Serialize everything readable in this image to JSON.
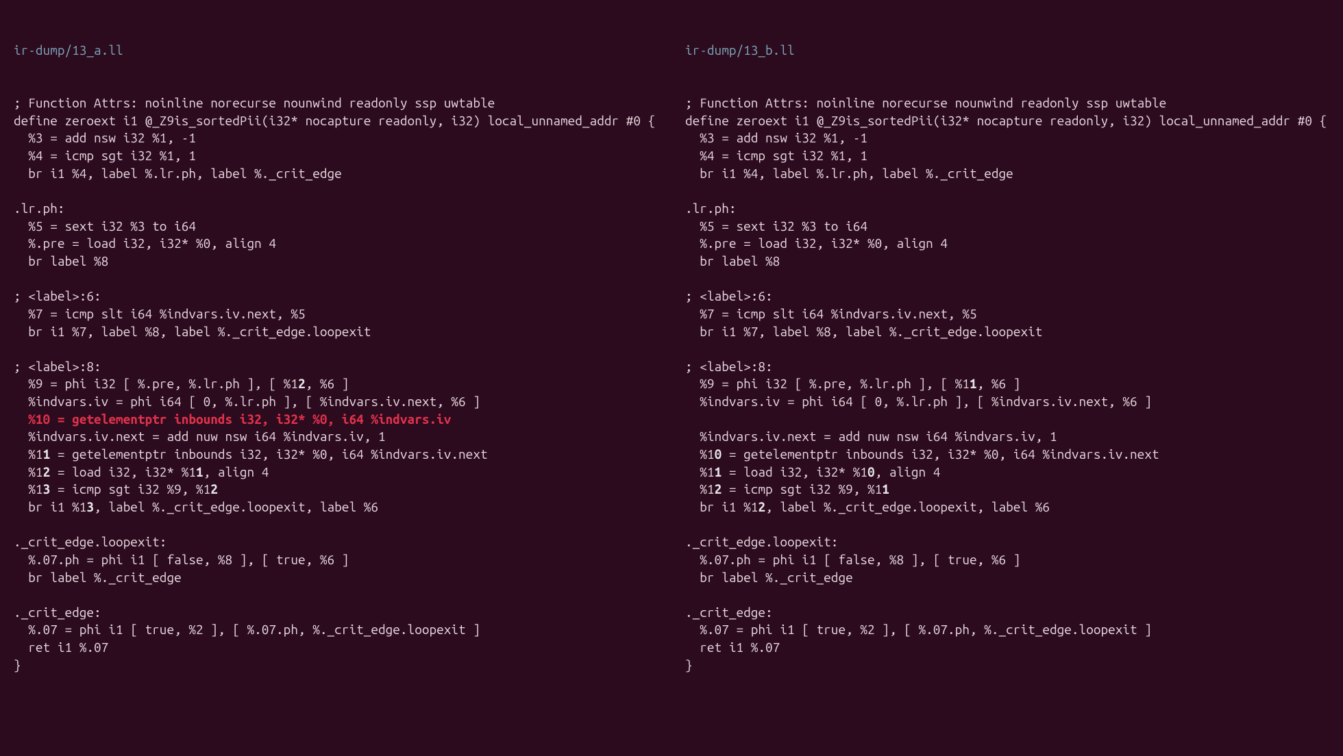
{
  "colors": {
    "background": "#2c0b1f",
    "text": "#e8d8df",
    "titleText": "#7fa5b8",
    "deletedLine": "#e2324a",
    "inlineChange": "#e6e6e6"
  },
  "left": {
    "title": "ir-dump/13_a.ll",
    "lines": [
      {
        "segments": [
          {
            "t": "; Function Attrs: noinline norecurse nounwind readonly ssp uwtable"
          }
        ]
      },
      {
        "segments": [
          {
            "t": "define zeroext i1 @_Z9is_sortedPii(i32* nocapture readonly, i32) local_unnamed_addr #0 {"
          }
        ]
      },
      {
        "segments": [
          {
            "t": "  %3 = add nsw i32 %1, -1"
          }
        ]
      },
      {
        "segments": [
          {
            "t": "  %4 = icmp sgt i32 %1, 1"
          }
        ]
      },
      {
        "segments": [
          {
            "t": "  br i1 %4, label %.lr.ph, label %._crit_edge"
          }
        ]
      },
      {
        "segments": [
          {
            "t": ""
          }
        ]
      },
      {
        "segments": [
          {
            "t": ".lr.ph:"
          }
        ]
      },
      {
        "segments": [
          {
            "t": "  %5 = sext i32 %3 to i64"
          }
        ]
      },
      {
        "segments": [
          {
            "t": "  %.pre = load i32, i32* %0, align 4"
          }
        ]
      },
      {
        "segments": [
          {
            "t": "  br label %8"
          }
        ]
      },
      {
        "segments": [
          {
            "t": ""
          }
        ]
      },
      {
        "segments": [
          {
            "t": "; <label>:6:"
          }
        ]
      },
      {
        "segments": [
          {
            "t": "  %7 = icmp slt i64 %indvars.iv.next, %5"
          }
        ]
      },
      {
        "segments": [
          {
            "t": "  br i1 %7, label %8, label %._crit_edge.loopexit"
          }
        ]
      },
      {
        "segments": [
          {
            "t": ""
          }
        ]
      },
      {
        "segments": [
          {
            "t": "; <label>:8:"
          }
        ]
      },
      {
        "segments": [
          {
            "t": "  %9 = phi i32 [ %.pre, %.lr.ph ], [ %1"
          },
          {
            "t": "2",
            "c": "hl-chg"
          },
          {
            "t": ", %6 ]"
          }
        ]
      },
      {
        "segments": [
          {
            "t": "  %indvars.iv = phi i64 [ 0, %.lr.ph ], [ %indvars.iv.next, %6 ]"
          }
        ]
      },
      {
        "segments": [
          {
            "t": "  %10 = getelementptr inbounds i32, i32* %0, i64 %indvars.iv",
            "c": "hl-del"
          }
        ]
      },
      {
        "segments": [
          {
            "t": "  %indvars.iv.next = add nuw nsw i64 %indvars.iv, 1"
          }
        ]
      },
      {
        "segments": [
          {
            "t": "  %1"
          },
          {
            "t": "1",
            "c": "hl-chg"
          },
          {
            "t": " = getelementptr inbounds i32, i32* %0, i64 %indvars.iv.next"
          }
        ]
      },
      {
        "segments": [
          {
            "t": "  %1"
          },
          {
            "t": "2",
            "c": "hl-chg"
          },
          {
            "t": " = load i32, i32* %1"
          },
          {
            "t": "1",
            "c": "hl-chg"
          },
          {
            "t": ", align 4"
          }
        ]
      },
      {
        "segments": [
          {
            "t": "  %1"
          },
          {
            "t": "3",
            "c": "hl-chg"
          },
          {
            "t": " = icmp sgt i32 %9, %1"
          },
          {
            "t": "2",
            "c": "hl-chg"
          }
        ]
      },
      {
        "segments": [
          {
            "t": "  br i1 %1"
          },
          {
            "t": "3",
            "c": "hl-chg"
          },
          {
            "t": ", label %._crit_edge.loopexit, label %6"
          }
        ]
      },
      {
        "segments": [
          {
            "t": ""
          }
        ]
      },
      {
        "segments": [
          {
            "t": "._crit_edge.loopexit:"
          }
        ]
      },
      {
        "segments": [
          {
            "t": "  %.07.ph = phi i1 [ false, %8 ], [ true, %6 ]"
          }
        ]
      },
      {
        "segments": [
          {
            "t": "  br label %._crit_edge"
          }
        ]
      },
      {
        "segments": [
          {
            "t": ""
          }
        ]
      },
      {
        "segments": [
          {
            "t": "._crit_edge:"
          }
        ]
      },
      {
        "segments": [
          {
            "t": "  %.07 = phi i1 [ true, %2 ], [ %.07.ph, %._crit_edge.loopexit ]"
          }
        ]
      },
      {
        "segments": [
          {
            "t": "  ret i1 %.07"
          }
        ]
      },
      {
        "segments": [
          {
            "t": "}"
          }
        ]
      }
    ]
  },
  "right": {
    "title": "ir-dump/13_b.ll",
    "lines": [
      {
        "segments": [
          {
            "t": "; Function Attrs: noinline norecurse nounwind readonly ssp uwtable"
          }
        ]
      },
      {
        "segments": [
          {
            "t": "define zeroext i1 @_Z9is_sortedPii(i32* nocapture readonly, i32) local_unnamed_addr #0 {"
          }
        ]
      },
      {
        "segments": [
          {
            "t": "  %3 = add nsw i32 %1, -1"
          }
        ]
      },
      {
        "segments": [
          {
            "t": "  %4 = icmp sgt i32 %1, 1"
          }
        ]
      },
      {
        "segments": [
          {
            "t": "  br i1 %4, label %.lr.ph, label %._crit_edge"
          }
        ]
      },
      {
        "segments": [
          {
            "t": ""
          }
        ]
      },
      {
        "segments": [
          {
            "t": ".lr.ph:"
          }
        ]
      },
      {
        "segments": [
          {
            "t": "  %5 = sext i32 %3 to i64"
          }
        ]
      },
      {
        "segments": [
          {
            "t": "  %.pre = load i32, i32* %0, align 4"
          }
        ]
      },
      {
        "segments": [
          {
            "t": "  br label %8"
          }
        ]
      },
      {
        "segments": [
          {
            "t": ""
          }
        ]
      },
      {
        "segments": [
          {
            "t": "; <label>:6:"
          }
        ]
      },
      {
        "segments": [
          {
            "t": "  %7 = icmp slt i64 %indvars.iv.next, %5"
          }
        ]
      },
      {
        "segments": [
          {
            "t": "  br i1 %7, label %8, label %._crit_edge.loopexit"
          }
        ]
      },
      {
        "segments": [
          {
            "t": ""
          }
        ]
      },
      {
        "segments": [
          {
            "t": "; <label>:8:"
          }
        ]
      },
      {
        "segments": [
          {
            "t": "  %9 = phi i32 [ %.pre, %.lr.ph ], [ %1"
          },
          {
            "t": "1",
            "c": "hl-chg"
          },
          {
            "t": ", %6 ]"
          }
        ]
      },
      {
        "segments": [
          {
            "t": "  %indvars.iv = phi i64 [ 0, %.lr.ph ], [ %indvars.iv.next, %6 ]"
          }
        ]
      },
      {
        "segments": [
          {
            "t": ""
          }
        ]
      },
      {
        "segments": [
          {
            "t": "  %indvars.iv.next = add nuw nsw i64 %indvars.iv, 1"
          }
        ]
      },
      {
        "segments": [
          {
            "t": "  %1"
          },
          {
            "t": "0",
            "c": "hl-chg"
          },
          {
            "t": " = getelementptr inbounds i32, i32* %0, i64 %indvars.iv.next"
          }
        ]
      },
      {
        "segments": [
          {
            "t": "  %1"
          },
          {
            "t": "1",
            "c": "hl-chg"
          },
          {
            "t": " = load i32, i32* %1"
          },
          {
            "t": "0",
            "c": "hl-chg"
          },
          {
            "t": ", align 4"
          }
        ]
      },
      {
        "segments": [
          {
            "t": "  %1"
          },
          {
            "t": "2",
            "c": "hl-chg"
          },
          {
            "t": " = icmp sgt i32 %9, %1"
          },
          {
            "t": "1",
            "c": "hl-chg"
          }
        ]
      },
      {
        "segments": [
          {
            "t": "  br i1 %1"
          },
          {
            "t": "2",
            "c": "hl-chg"
          },
          {
            "t": ", label %._crit_edge.loopexit, label %6"
          }
        ]
      },
      {
        "segments": [
          {
            "t": ""
          }
        ]
      },
      {
        "segments": [
          {
            "t": "._crit_edge.loopexit:"
          }
        ]
      },
      {
        "segments": [
          {
            "t": "  %.07.ph = phi i1 [ false, %8 ], [ true, %6 ]"
          }
        ]
      },
      {
        "segments": [
          {
            "t": "  br label %._crit_edge"
          }
        ]
      },
      {
        "segments": [
          {
            "t": ""
          }
        ]
      },
      {
        "segments": [
          {
            "t": "._crit_edge:"
          }
        ]
      },
      {
        "segments": [
          {
            "t": "  %.07 = phi i1 [ true, %2 ], [ %.07.ph, %._crit_edge.loopexit ]"
          }
        ]
      },
      {
        "segments": [
          {
            "t": "  ret i1 %.07"
          }
        ]
      },
      {
        "segments": [
          {
            "t": "}"
          }
        ]
      }
    ]
  }
}
